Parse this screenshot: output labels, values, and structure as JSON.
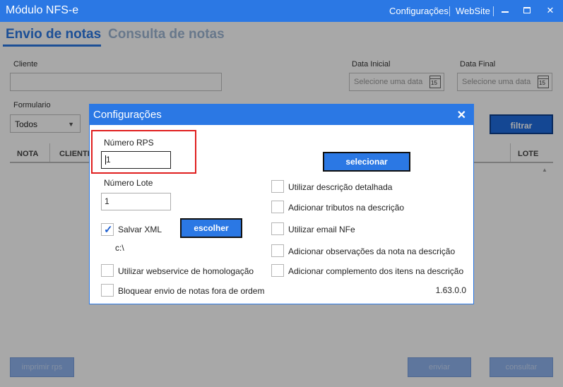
{
  "window": {
    "title": "Módulo NFS-e",
    "links": [
      "Configurações",
      "WebSite"
    ],
    "close_glyph": "✕"
  },
  "tabs": [
    {
      "label": "Envio de notas",
      "active": true
    },
    {
      "label": "Consulta de notas",
      "active": false
    }
  ],
  "form": {
    "cliente_label": "Cliente",
    "data_inicial_label": "Data Inicial",
    "data_inicial_placeholder": "Selecione uma data",
    "data_final_label": "Data Final",
    "data_final_placeholder": "Selecione uma data",
    "calendar_day": "15",
    "formulario_label": "Formulario",
    "formulario_value": "Todos",
    "filter_button": "filtrar"
  },
  "grid": {
    "columns": [
      "NOTA",
      "CLIENTE",
      "LOTE"
    ]
  },
  "bottom_buttons": [
    "imprimir rps",
    "enviar",
    "consultar"
  ],
  "dialog": {
    "title": "Configurações",
    "close_glyph": "✕",
    "numero_rps_label": "Número RPS",
    "numero_rps_value": "1",
    "numero_lote_label": "Número Lote",
    "numero_lote_value": "1",
    "salvar_xml_label": "Salvar XML",
    "salvar_xml_checked": true,
    "escolher_pasta_button": "escolher pasta",
    "folder_path": "c:\\",
    "webservice_homologacao_label": "Utilizar webservice de homologação",
    "bloquear_envio_label": "Bloquear envio de notas fora de ordem",
    "selecionar_certificado_button": "selecionar certificado",
    "options": [
      "Utilizar descrição detalhada",
      "Adicionar tributos na descrição",
      "Utilizar email NFe",
      "Adicionar observações da nota na descrição",
      "Adicionar complemento dos itens na descrição"
    ],
    "version": "1.63.0.0",
    "highlight_color": "#e01f1f"
  },
  "colors": {
    "accent": "#2b78e4",
    "overlay": "rgba(0,0,0,0.34)"
  }
}
